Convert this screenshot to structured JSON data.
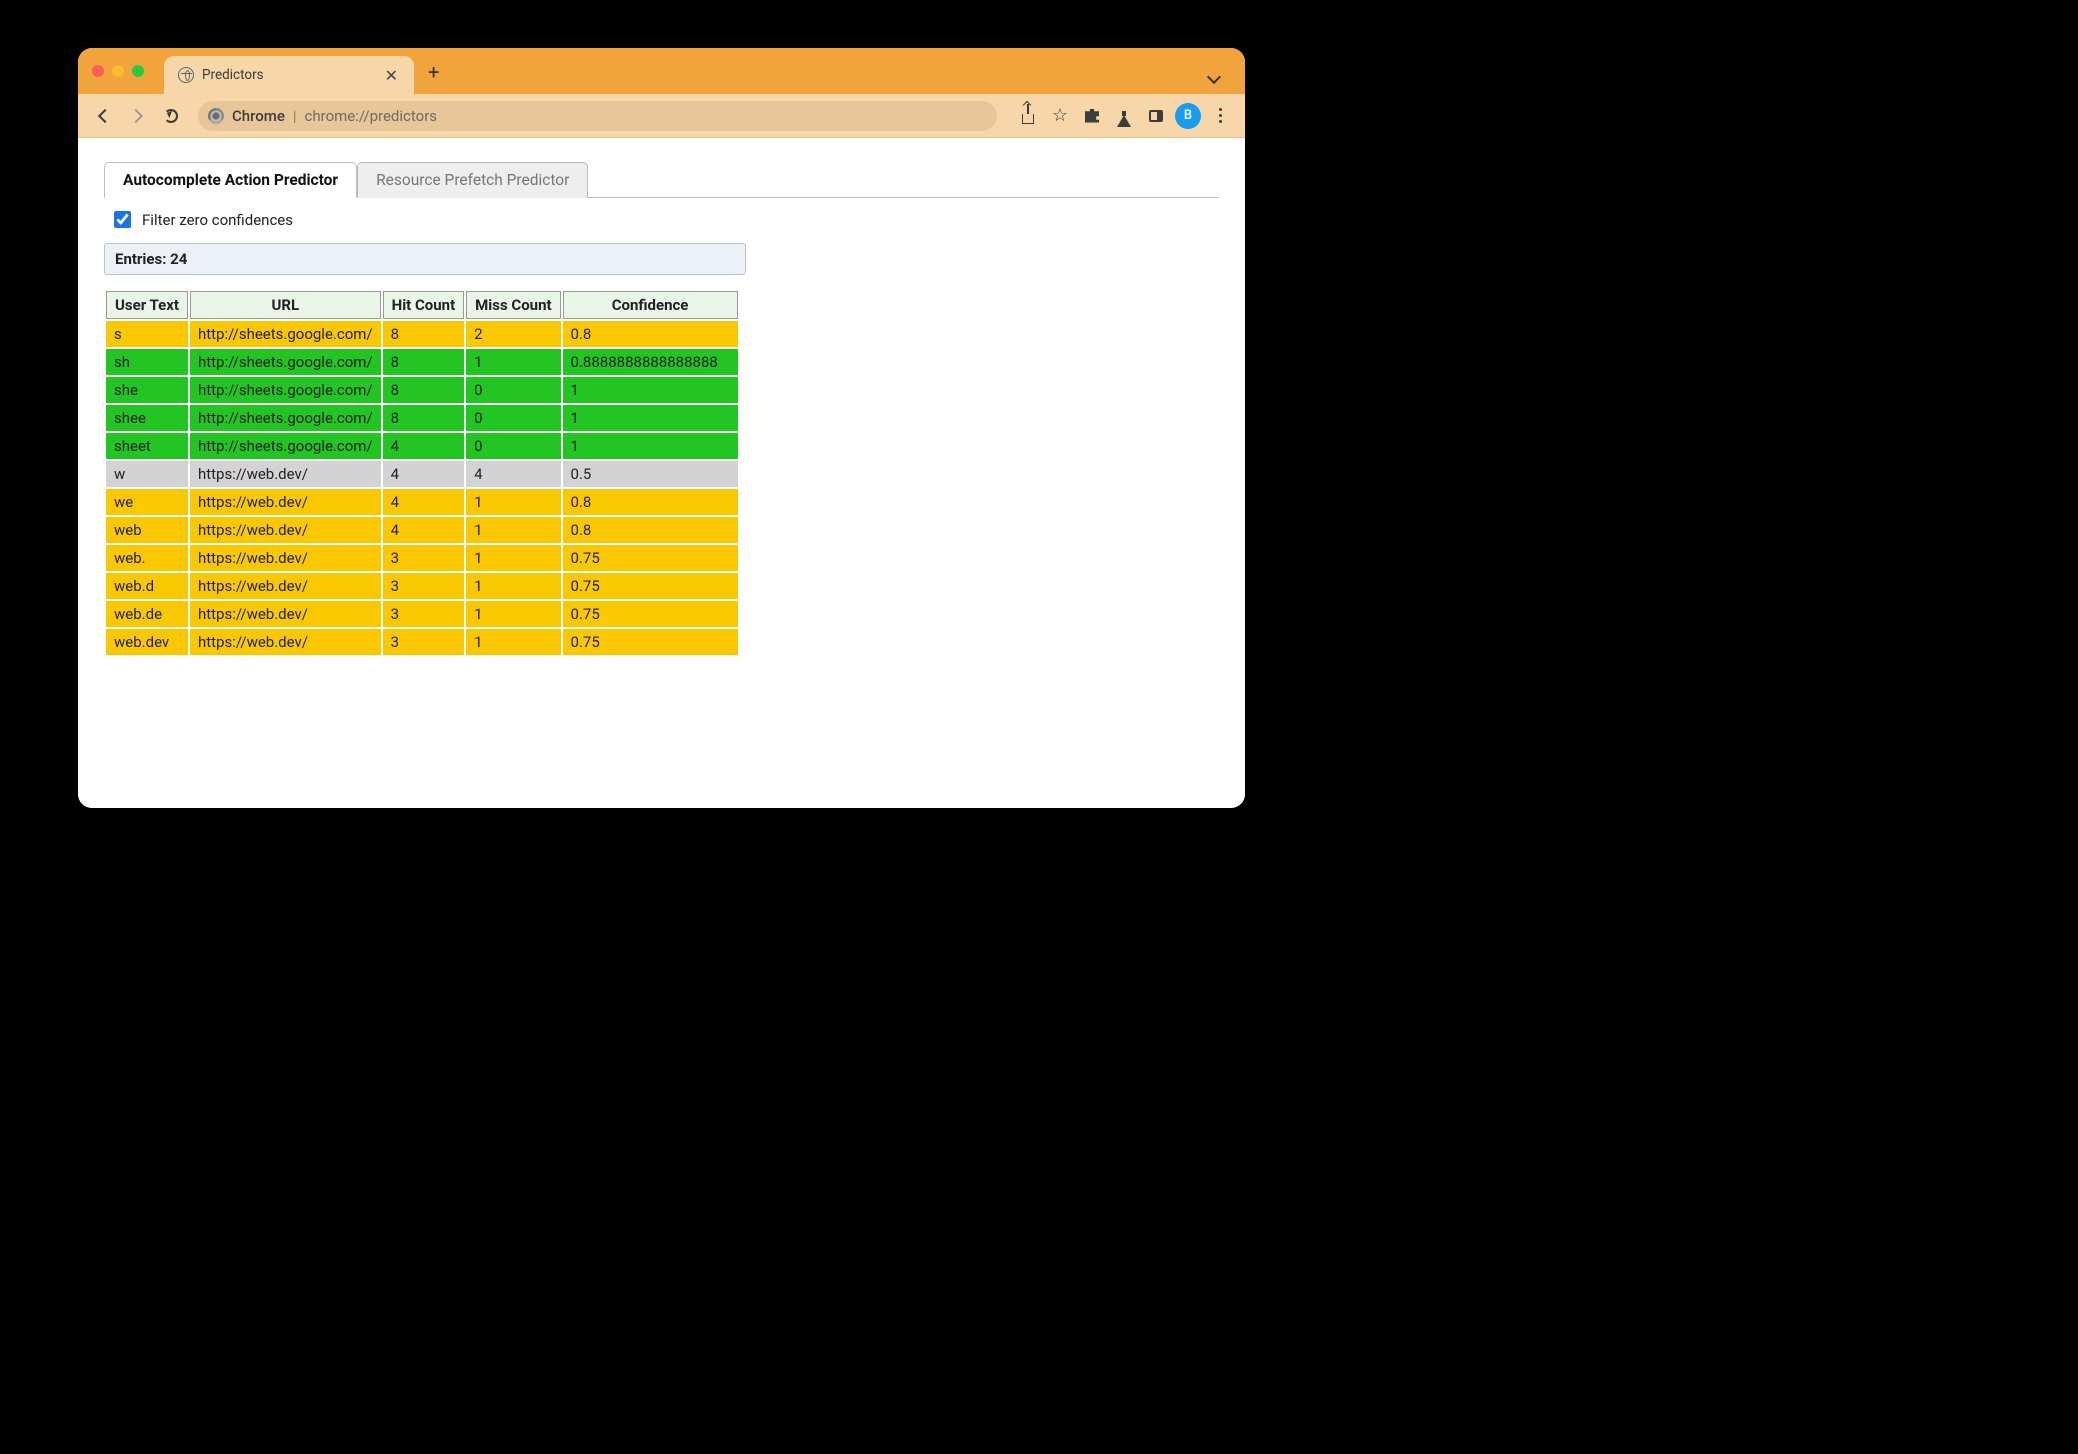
{
  "browser": {
    "tab_title": "Predictors",
    "omnibox_prefix": "Chrome",
    "omnibox_url": "chrome://predictors",
    "avatar_letter": "B"
  },
  "page": {
    "tabs": {
      "active": "Autocomplete Action Predictor",
      "inactive": "Resource Prefetch Predictor"
    },
    "filter_label": "Filter zero confidences",
    "filter_checked": true,
    "entries_label": "Entries: 24",
    "columns": {
      "user_text": "User Text",
      "url": "URL",
      "hit": "Hit Count",
      "miss": "Miss Count",
      "conf": "Confidence"
    },
    "rows": [
      {
        "user_text": "s",
        "url": "http://sheets.google.com/",
        "hit": "8",
        "miss": "2",
        "conf": "0.8",
        "level": "yellow"
      },
      {
        "user_text": "sh",
        "url": "http://sheets.google.com/",
        "hit": "8",
        "miss": "1",
        "conf": "0.8888888888888888",
        "level": "green"
      },
      {
        "user_text": "she",
        "url": "http://sheets.google.com/",
        "hit": "8",
        "miss": "0",
        "conf": "1",
        "level": "green"
      },
      {
        "user_text": "shee",
        "url": "http://sheets.google.com/",
        "hit": "8",
        "miss": "0",
        "conf": "1",
        "level": "green"
      },
      {
        "user_text": "sheet",
        "url": "http://sheets.google.com/",
        "hit": "4",
        "miss": "0",
        "conf": "1",
        "level": "green"
      },
      {
        "user_text": "w",
        "url": "https://web.dev/",
        "hit": "4",
        "miss": "4",
        "conf": "0.5",
        "level": "grey"
      },
      {
        "user_text": "we",
        "url": "https://web.dev/",
        "hit": "4",
        "miss": "1",
        "conf": "0.8",
        "level": "yellow"
      },
      {
        "user_text": "web",
        "url": "https://web.dev/",
        "hit": "4",
        "miss": "1",
        "conf": "0.8",
        "level": "yellow"
      },
      {
        "user_text": "web.",
        "url": "https://web.dev/",
        "hit": "3",
        "miss": "1",
        "conf": "0.75",
        "level": "yellow"
      },
      {
        "user_text": "web.d",
        "url": "https://web.dev/",
        "hit": "3",
        "miss": "1",
        "conf": "0.75",
        "level": "yellow"
      },
      {
        "user_text": "web.de",
        "url": "https://web.dev/",
        "hit": "3",
        "miss": "1",
        "conf": "0.75",
        "level": "yellow"
      },
      {
        "user_text": "web.dev",
        "url": "https://web.dev/",
        "hit": "3",
        "miss": "1",
        "conf": "0.75",
        "level": "yellow"
      }
    ]
  }
}
